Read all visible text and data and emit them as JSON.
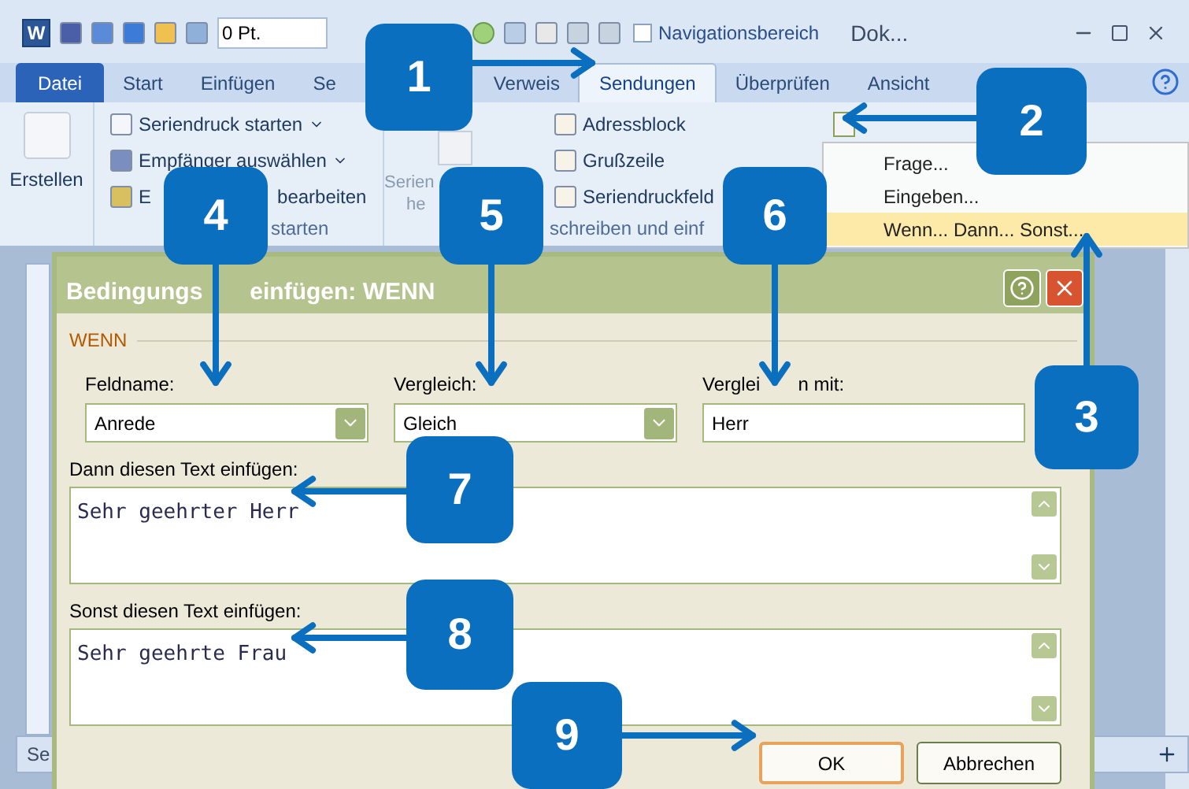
{
  "title_bar": {
    "app_logo": "W",
    "font_size": "0 Pt.",
    "navigation_pane": {
      "label": "Navigationsbereich",
      "checked": false
    },
    "document_title": "Dok..."
  },
  "tabs": [
    {
      "label": "Datei",
      "kind": "file",
      "selected": false
    },
    {
      "label": "Start",
      "kind": "tab",
      "selected": false
    },
    {
      "label": "Einfügen",
      "kind": "tab",
      "selected": false
    },
    {
      "label": "Se",
      "kind": "tab",
      "selected": false
    },
    {
      "label": "Verweis",
      "kind": "tab",
      "selected": false
    },
    {
      "label": "Sendungen",
      "kind": "tab",
      "selected": true
    },
    {
      "label": "Überprüfen",
      "kind": "tab",
      "selected": false
    },
    {
      "label": "Ansicht",
      "kind": "tab",
      "selected": false
    }
  ],
  "ribbon": {
    "create_button": "Erstellen",
    "start_group": {
      "commands": [
        {
          "label": "Seriendruck starten",
          "dropdown": true
        },
        {
          "label": "Empfänger auswählen",
          "dropdown": true
        },
        {
          "label": "E",
          "label_end": "bearbeiten",
          "dropdown": false
        }
      ],
      "label": "starten"
    },
    "fields_group": {
      "large_button_lines": [
        "Serien",
        "he"
      ],
      "commands": [
        "Adressblock",
        "Grußzeile",
        "Seriendruckfeld"
      ],
      "label": "schreiben und einf"
    }
  },
  "rules_menu": {
    "items": [
      {
        "label": "Frage...",
        "selected": false
      },
      {
        "label": "Eingeben...",
        "selected": false
      },
      {
        "label": "Wenn... Dann... Sonst...",
        "selected": true
      }
    ]
  },
  "dialog": {
    "title_start": "Bedingungs",
    "title_end": "einfügen: WENN",
    "section": "WENN",
    "fields": [
      {
        "label": "Feldname:",
        "value": "Anrede",
        "kind": "combo"
      },
      {
        "label": "Vergleich:",
        "value": "Gleich",
        "kind": "combo"
      },
      {
        "label": "Verglei",
        "label_end": "n mit:",
        "value": "Herr",
        "kind": "text"
      }
    ],
    "then_label": "Dann diesen Text einfügen:",
    "then_text": "Sehr geehrter Herr",
    "else_label": "Sonst diesen Text einfügen:",
    "else_text": "Sehr geehrte Frau",
    "buttons": [
      {
        "label": "OK",
        "default": true
      },
      {
        "label": "Abbrechen",
        "default": false
      }
    ]
  },
  "status_bar": {
    "text": "Se"
  },
  "callouts": [
    "1",
    "2",
    "3",
    "4",
    "5",
    "6",
    "7",
    "8",
    "9"
  ]
}
